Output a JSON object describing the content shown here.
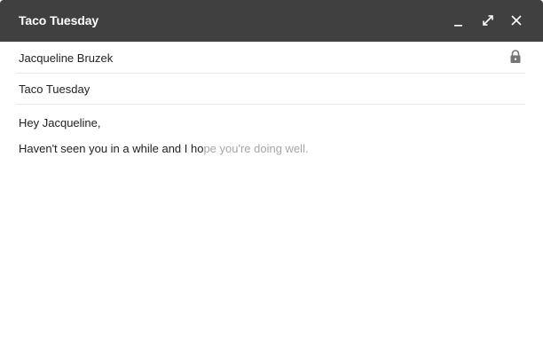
{
  "window": {
    "title": "Taco Tuesday"
  },
  "compose": {
    "to": "Jacqueline Bruzek",
    "subject": "Taco Tuesday",
    "body": {
      "greeting": "Hey Jacqueline,",
      "typed_text": "Haven't seen you in a while and I ho",
      "suggestion_text": "pe you're doing well."
    }
  },
  "colors": {
    "titlebar": "#404040",
    "suggestion": "#a6a6a6",
    "text": "#222222"
  },
  "icons": {
    "minimize": "minimize-icon",
    "expand": "expand-icon",
    "close": "close-icon",
    "lock": "lock-icon"
  }
}
